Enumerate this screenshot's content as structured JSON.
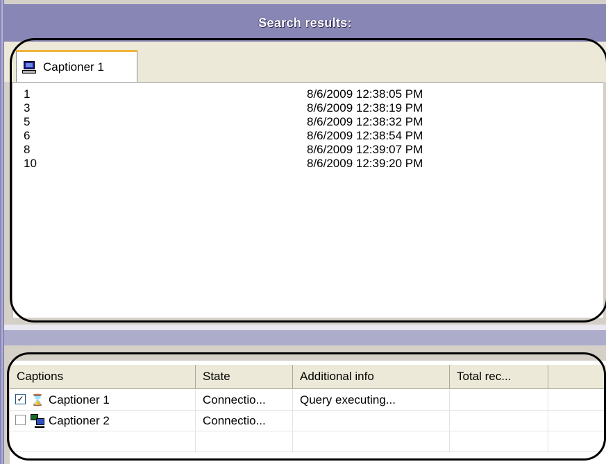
{
  "panel": {
    "title": "Search results:"
  },
  "tabs": [
    {
      "label": "Captioner 1",
      "icon": "computer-icon"
    }
  ],
  "results": [
    {
      "id": "1",
      "time": "8/6/2009 12:38:05 PM"
    },
    {
      "id": "3",
      "time": "8/6/2009 12:38:19 PM"
    },
    {
      "id": "5",
      "time": "8/6/2009 12:38:32 PM"
    },
    {
      "id": "6",
      "time": "8/6/2009 12:38:54 PM"
    },
    {
      "id": "8",
      "time": "8/6/2009 12:39:07 PM"
    },
    {
      "id": "10",
      "time": "8/6/2009 12:39:20 PM"
    }
  ],
  "grid": {
    "columns": [
      "Captions",
      "State",
      "Additional info",
      "Total rec..."
    ],
    "rows": [
      {
        "checked": true,
        "check_mark": "✓",
        "icon": "hourglass-icon",
        "caption": "Captioner 1",
        "state": "Connectio...",
        "info": "Query executing...",
        "total": ""
      },
      {
        "checked": false,
        "check_mark": "",
        "icon": "network-computer-icon",
        "caption": "Captioner 2",
        "state": "Connectio...",
        "info": "",
        "total": ""
      }
    ]
  },
  "colors": {
    "title_bar": "#8886b4",
    "tab_highlight": "#f2b43c",
    "annotation_outline": "#000000"
  }
}
